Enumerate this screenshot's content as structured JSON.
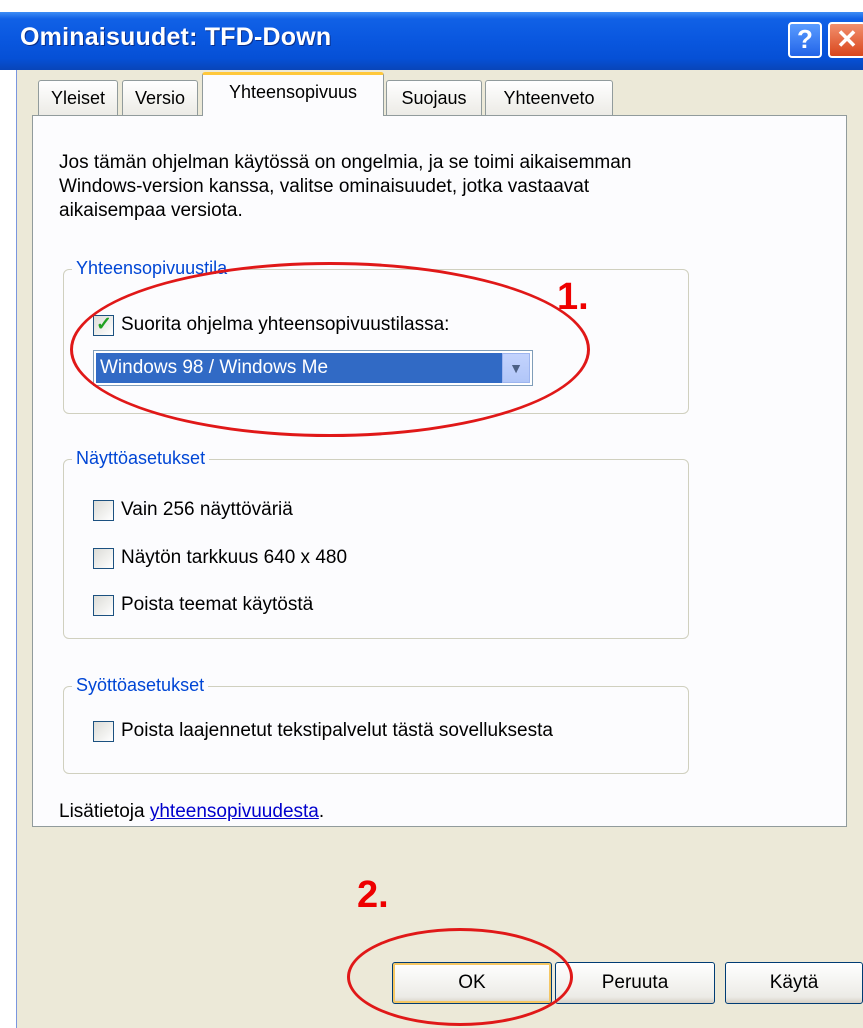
{
  "window": {
    "title": "Ominaisuudet: TFD-Down",
    "help_glyph": "?",
    "close_glyph": "✕"
  },
  "tabs": [
    {
      "label": "Yleiset",
      "active": false
    },
    {
      "label": "Versio",
      "active": false
    },
    {
      "label": "Yhteensopivuus",
      "active": true
    },
    {
      "label": "Suojaus",
      "active": false
    },
    {
      "label": "Yhteenveto",
      "active": false
    }
  ],
  "intro": {
    "line1": "Jos tämän ohjelman käytössä on ongelmia, ja se toimi aikaisemman",
    "line2": "Windows-version kanssa, valitse ominaisuudet, jotka vastaavat",
    "line3": "aikaisempaa versiota."
  },
  "compat_group": {
    "legend": "Yhteensopivuustila",
    "run_checkbox": {
      "label": "Suorita ohjelma yhteensopivuustilassa:",
      "checked": true
    },
    "mode_select": {
      "value": "Windows 98 / Windows Me"
    }
  },
  "display_group": {
    "legend": "Näyttöasetukset",
    "options": [
      {
        "label": "Vain 256 näyttöväriä",
        "checked": false
      },
      {
        "label": "Näytön tarkkuus 640 x 480",
        "checked": false
      },
      {
        "label": "Poista teemat käytöstä",
        "checked": false
      }
    ]
  },
  "input_group": {
    "legend": "Syöttöasetukset",
    "option": {
      "label": "Poista laajennetut tekstipalvelut tästä sovelluksesta",
      "checked": false
    }
  },
  "more_info": {
    "prefix": "Lisätietoja ",
    "link": "yhteensopivuudesta",
    "suffix": "."
  },
  "buttons": {
    "ok": "OK",
    "cancel": "Peruuta",
    "apply": "Käytä"
  },
  "annotations": {
    "step1": "1.",
    "step2": "2.",
    "color": "#ee0000"
  }
}
